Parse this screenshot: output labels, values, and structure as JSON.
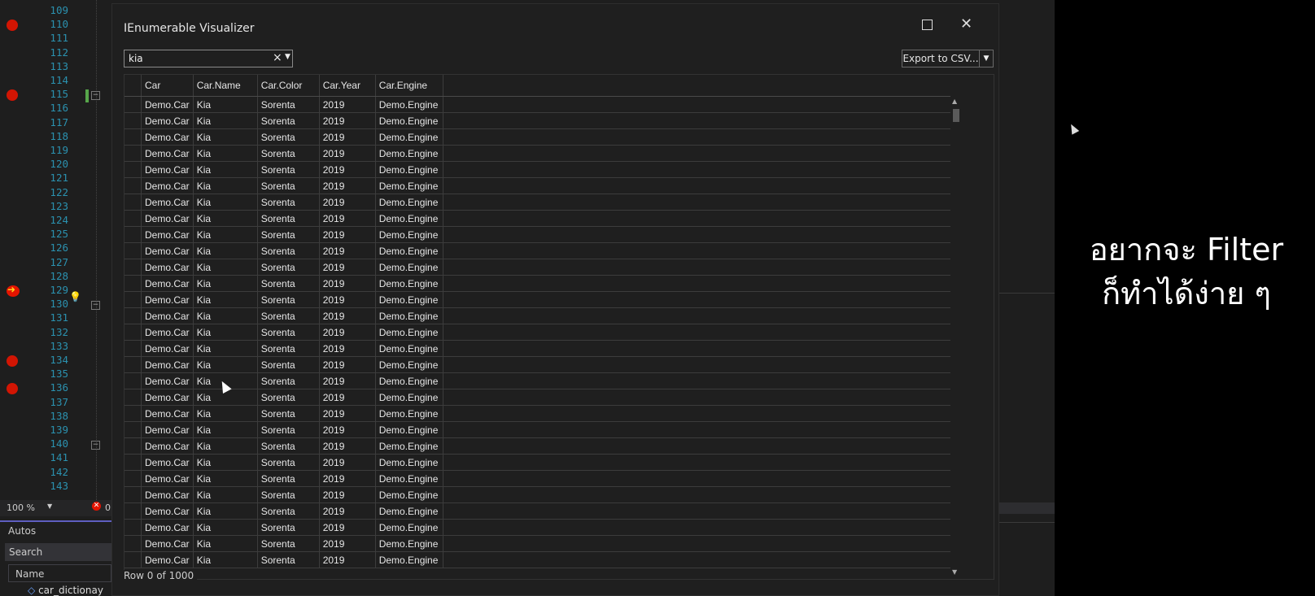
{
  "editor": {
    "line_numbers": [
      "109",
      "110",
      "111",
      "112",
      "113",
      "114",
      "115",
      "116",
      "117",
      "118",
      "119",
      "120",
      "121",
      "122",
      "123",
      "124",
      "125",
      "126",
      "127",
      "128",
      "129",
      "130",
      "131",
      "132",
      "133",
      "134",
      "135",
      "136",
      "137",
      "138",
      "139",
      "140",
      "141",
      "142",
      "143"
    ],
    "zoom": "100 %",
    "error_count": "0"
  },
  "autos": {
    "title": "Autos",
    "search_placeholder": "Search",
    "name_header": "Name",
    "row_label": "car_dictionay"
  },
  "dialog": {
    "title": "IEnumerable Visualizer",
    "filter_value": "kia",
    "export_label": "Export to CSV...",
    "columns": [
      "Car",
      "Car.Name",
      "Car.Color",
      "Car.Year",
      "Car.Engine"
    ],
    "row": [
      "Demo.Car",
      "Kia",
      "Sorenta",
      "2019",
      "Demo.Engine"
    ],
    "row_info": "Row 0 of 1000"
  },
  "caption": {
    "line1": "อยากจะ Filter",
    "line2": "ก็ทำได้ง่าย ๆ"
  }
}
